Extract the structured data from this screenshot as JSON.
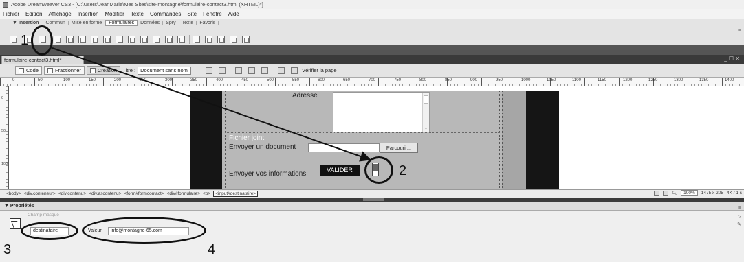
{
  "window": {
    "title": "Adobe Dreamweaver CS3 - [C:\\Users\\JeanMarie\\Mes Sites\\site-montagne\\formulaire-contact3.html (XHTML)*]"
  },
  "menu": [
    "Fichier",
    "Edition",
    "Affichage",
    "Insertion",
    "Modifier",
    "Texte",
    "Commandes",
    "Site",
    "Fenêtre",
    "Aide"
  ],
  "insert_tabs": [
    "Commun",
    "Mise en forme",
    "Formulaires",
    "Données",
    "Spry",
    "Texte",
    "Favoris"
  ],
  "active_insert_tab": "Formulaires",
  "insert_bar_label": "▼ Insertion",
  "document": {
    "tab_label": "formulaire-contact3.html*",
    "window_controls": "_ ☐ ✕",
    "view_buttons": {
      "code": "Code",
      "split": "Fractionner",
      "design": "Création"
    },
    "title_label": "Titre :",
    "title_value": "Document sans nom",
    "validate_label": "Vérifier la page"
  },
  "ruler": {
    "h_ticks": [
      "0",
      "50",
      "100",
      "150",
      "200",
      "250",
      "300",
      "350",
      "400",
      "450",
      "500",
      "550",
      "600",
      "650",
      "700",
      "750",
      "800",
      "850",
      "900",
      "950",
      "1000",
      "1050",
      "1100",
      "1150",
      "1200",
      "1250",
      "1300",
      "1350",
      "1400",
      "1450"
    ],
    "v_ticks": [
      "0",
      "50",
      "100"
    ]
  },
  "form": {
    "adresse_label": "Adresse",
    "fichier_joint_label": "Fichier joint",
    "envoyer_document_label": "Envoyer un document",
    "browse_button": "Parcourir...",
    "envoyer_infos_label": "Envoyer vos informations",
    "submit_button": "VALIDER"
  },
  "tag_selector": {
    "tags": [
      "<body>",
      "<div.conteneur>",
      "<div.contenu>",
      "<div.ascontenu>",
      "<form#formcontact>",
      "<div#formulaire>",
      "<p>"
    ],
    "active_tag": "<input#destinataire>"
  },
  "status": {
    "zoom": "100%",
    "size": "1475 x 205",
    "weight": "4K / 1 s"
  },
  "properties": {
    "header": "▼ Propriétés",
    "hidden_field_hint": "Champ masqué",
    "name_value": "destinataire",
    "value_label": "Valeur",
    "value_value": "info@montagne-65.com"
  },
  "annotations": {
    "n1": "1",
    "n2": "2",
    "n3": "3",
    "n4": "4"
  }
}
